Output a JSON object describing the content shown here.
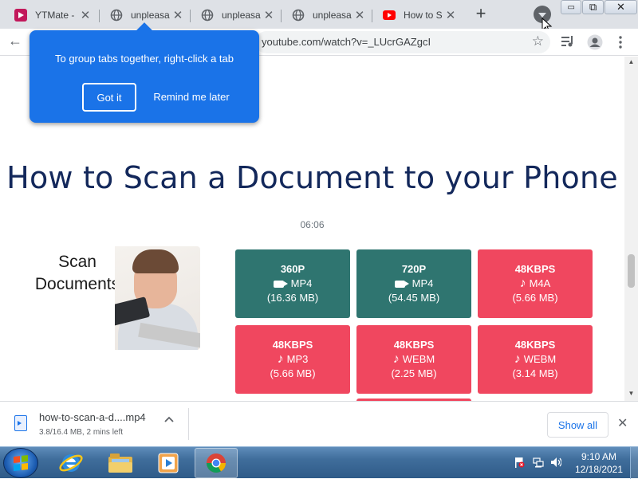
{
  "tabs": [
    {
      "title": "YTMate -",
      "favicon": "ytmate-icon"
    },
    {
      "title": "unpleasa",
      "favicon": "globe-icon"
    },
    {
      "title": "unpleasa",
      "favicon": "globe-icon"
    },
    {
      "title": "unpleasa",
      "favicon": "globe-icon"
    },
    {
      "title": "How to S",
      "favicon": "youtube-icon"
    }
  ],
  "new_tab": "+",
  "window_controls": {
    "minimize": "▭",
    "restore": "⧉",
    "close": "✕"
  },
  "toolbar": {
    "back": "←",
    "url": "youtube.com/watch?v=_LUcrGAZgcI",
    "star": "☆"
  },
  "callout": {
    "message": "To group tabs together, right-click a tab",
    "got_it": "Got it",
    "remind_later": "Remind me later"
  },
  "video": {
    "title": "How to Scan a Document to your Phone",
    "duration": "06:06",
    "thumbnail_text_1": "Scan",
    "thumbnail_text_2": "Documents"
  },
  "formats": [
    {
      "quality": "360P",
      "type": "MP4",
      "size": "(16.36 MB)",
      "kind": "video",
      "color": "#2f7570"
    },
    {
      "quality": "720P",
      "type": "MP4",
      "size": "(54.45 MB)",
      "kind": "video",
      "color": "#2f7570"
    },
    {
      "quality": "48KBPS",
      "type": "M4A",
      "size": "(5.66 MB)",
      "kind": "audio",
      "color": "#f0475f"
    },
    {
      "quality": "48KBPS",
      "type": "MP3",
      "size": "(5.66 MB)",
      "kind": "audio",
      "color": "#f0475f"
    },
    {
      "quality": "48KBPS",
      "type": "WEBM",
      "size": "(2.25 MB)",
      "kind": "audio",
      "color": "#f0475f"
    },
    {
      "quality": "48KBPS",
      "type": "WEBM",
      "size": "(3.14 MB)",
      "kind": "audio",
      "color": "#f0475f"
    }
  ],
  "download": {
    "filename": "how-to-scan-a-d....mp4",
    "status": "3.8/16.4 MB, 2 mins left",
    "show_all": "Show all"
  },
  "taskbar": {
    "time": "9:10 AM",
    "date": "12/18/2021"
  }
}
